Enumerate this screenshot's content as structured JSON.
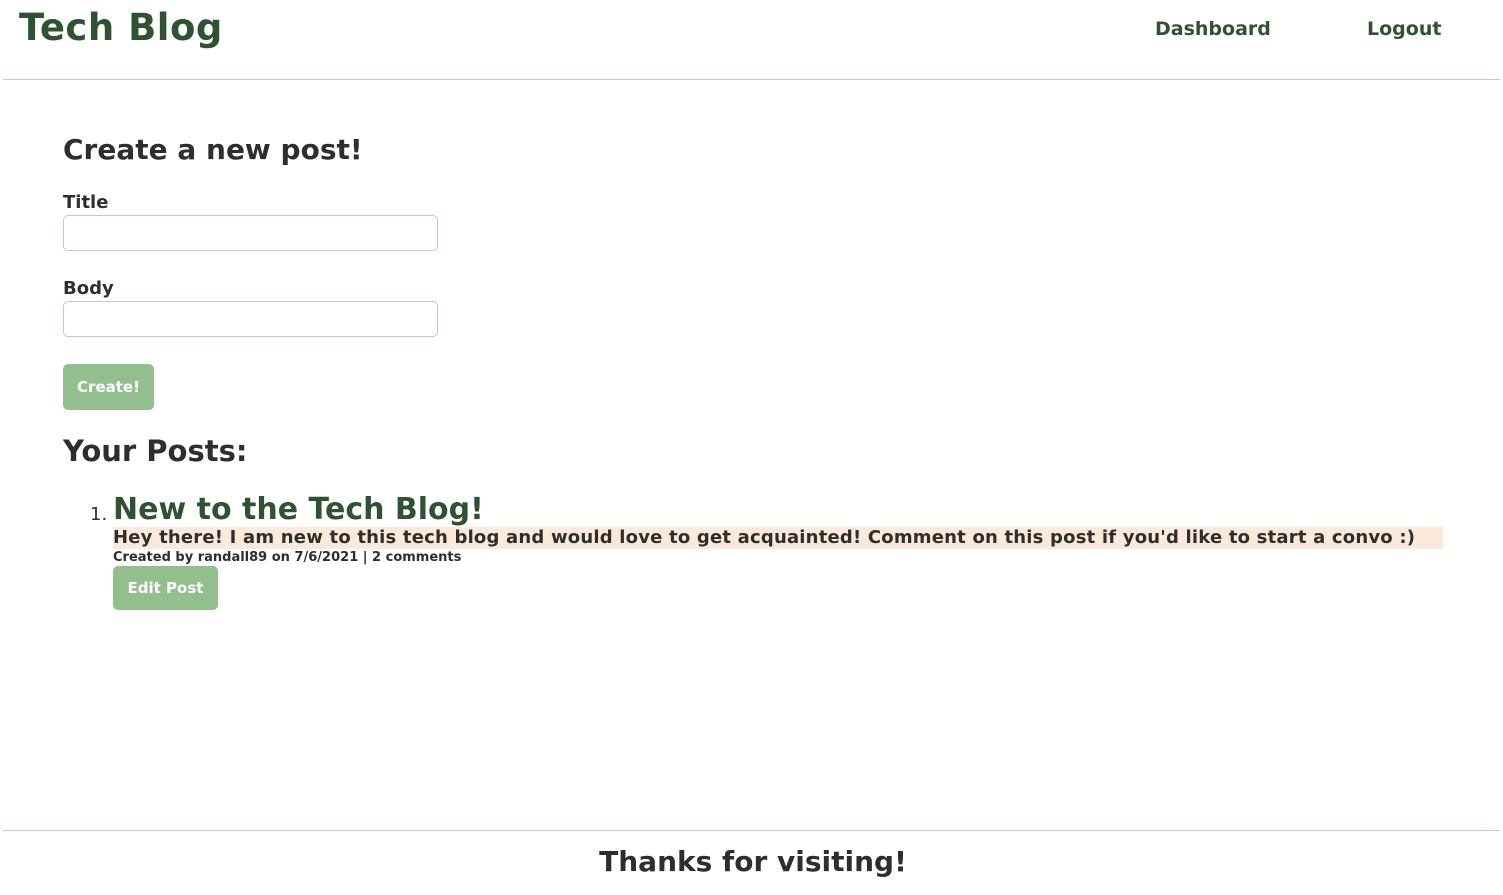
{
  "header": {
    "site_title": "Tech Blog",
    "nav": {
      "dashboard": "Dashboard",
      "logout": "Logout"
    }
  },
  "new_post_form": {
    "heading": "Create a new post!",
    "title_label": "Title",
    "title_value": "",
    "body_label": "Body",
    "body_value": "",
    "submit_label": "Create!"
  },
  "posts_section": {
    "heading": "Your Posts:",
    "posts": [
      {
        "number": "1.",
        "title": "New to the Tech Blog!",
        "body": "Hey there! I am new to this tech blog and would love to get acquainted! Comment on this post if you'd like to start a convo :)",
        "meta": "Created by randall89 on 7/6/2021 | 2 comments",
        "edit_label": "Edit Post"
      }
    ]
  },
  "footer": {
    "text": "Thanks for visiting!"
  },
  "colors": {
    "brand_green": "#2f5233",
    "button_green": "#93bf8e",
    "border_green": "#b7d3b0",
    "post_body_highlight": "#fbeadb"
  }
}
